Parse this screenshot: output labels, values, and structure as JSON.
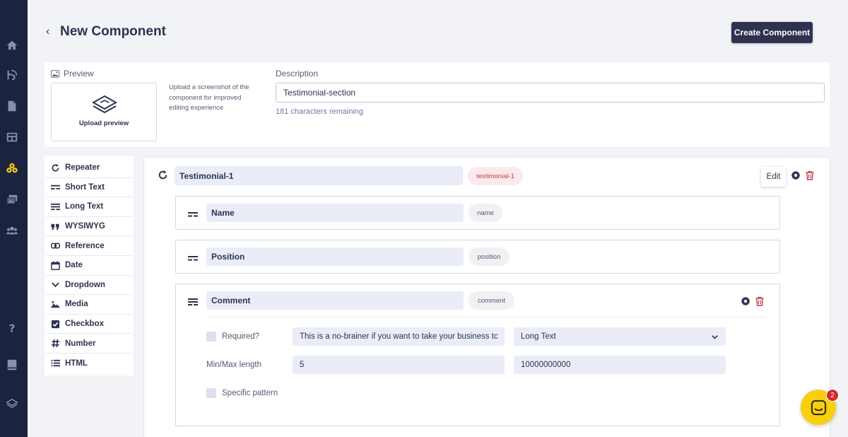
{
  "header": {
    "title": "New Component",
    "create_label": "Create Component"
  },
  "preview": {
    "label": "Preview",
    "upload_label": "Upload preview",
    "hint": "Upload a screenshot of the component for improved editing experience"
  },
  "description": {
    "label": "Description",
    "value": "Testimonial-section",
    "remaining": "181 characters remaining"
  },
  "palette": [
    {
      "label": "Repeater",
      "icon": "repeater-icon"
    },
    {
      "label": "Short Text",
      "icon": "short-text-icon"
    },
    {
      "label": "Long Text",
      "icon": "long-text-icon"
    },
    {
      "label": "WYSIWYG",
      "icon": "quote-icon"
    },
    {
      "label": "Reference",
      "icon": "link-icon"
    },
    {
      "label": "Date",
      "icon": "calendar-icon"
    },
    {
      "label": "Dropdown",
      "icon": "chevron-down-icon"
    },
    {
      "label": "Media",
      "icon": "image-icon"
    },
    {
      "label": "Checkbox",
      "icon": "checkbox-icon"
    },
    {
      "label": "Number",
      "icon": "hash-icon"
    },
    {
      "label": "HTML",
      "icon": "list-icon"
    }
  ],
  "repeater": {
    "name": "Testimonial-1",
    "slug": "testimonial-1",
    "edit_label": "Edit"
  },
  "fields": [
    {
      "name": "Name",
      "slug": "name"
    },
    {
      "name": "Position",
      "slug": "position"
    },
    {
      "name": "Comment",
      "slug": "comment"
    }
  ],
  "comment_settings": {
    "required_label": "Required?",
    "required_value": "This is a no-brainer if you want to take your business tc",
    "type_value": "Long Text",
    "minmax_label": "Min/Max length",
    "min_value": "5",
    "max_value": "10000000000",
    "pattern_label": "Specific pattern"
  },
  "chat": {
    "badge": "2"
  },
  "colors": {
    "sidebar": "#1c2340",
    "primary": "#2d3250",
    "accent_yellow": "#f7cf0f",
    "delete_red": "#c33a4b"
  }
}
